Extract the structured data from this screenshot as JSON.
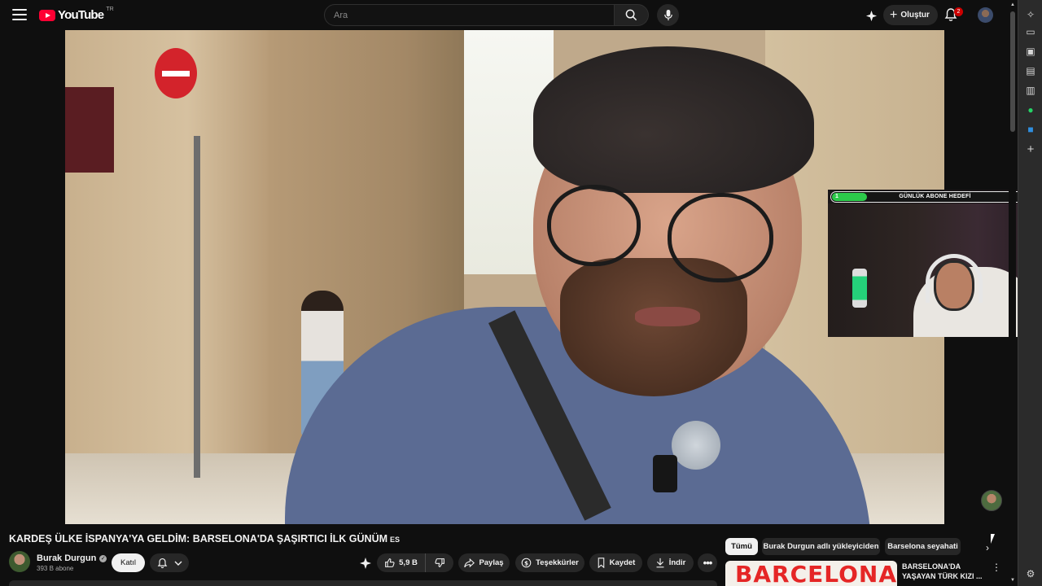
{
  "header": {
    "logo_text": "YouTube",
    "logo_country": "TR",
    "search_placeholder": "Ara",
    "create_label": "Oluştur",
    "notification_count": "2"
  },
  "overlay": {
    "goal_title": "GÜNLÜK ABONE HEDEFİ",
    "goal_current": "1",
    "goal_target": "6"
  },
  "video": {
    "title": "KARDEŞ ÜLKE İSPANYA'YA GELDİM: BARSELONA'DA ŞAŞIRTICI İLK GÜNÜM",
    "language_tag": "ES"
  },
  "channel": {
    "name": "Burak Durgun",
    "subscribers": "393 B abone",
    "join_label": "Katıl"
  },
  "actions": {
    "likes": "5,9 B",
    "share_label": "Paylaş",
    "thanks_label": "Teşekkürler",
    "save_label": "Kaydet",
    "download_label": "İndir"
  },
  "chips": [
    {
      "label": "Tümü",
      "active": true
    },
    {
      "label": "Burak Durgun adlı yükleyiciden",
      "active": false
    },
    {
      "label": "Barselona seyahati",
      "active": false
    }
  ],
  "recommendation": {
    "thumb_text": "BARCELONA",
    "title": "BARSELONA'DA YAŞAYAN TÜRK KIZI ..."
  },
  "colors": {
    "background": "#0f0f0f",
    "surface": "#272727",
    "brand_red": "#ff0033",
    "goal_green": "#2cc94a"
  },
  "icons": {
    "menu": "hamburger-icon",
    "search": "search-icon",
    "mic": "microphone-icon",
    "create": "plus-icon",
    "notifications": "bell-icon",
    "like": "thumbs-up-icon",
    "dislike": "thumbs-down-icon",
    "share": "share-arrow-icon",
    "thanks": "dollar-heart-icon",
    "save": "bookmark-icon",
    "download": "download-icon",
    "more": "more-horizontal-icon"
  }
}
